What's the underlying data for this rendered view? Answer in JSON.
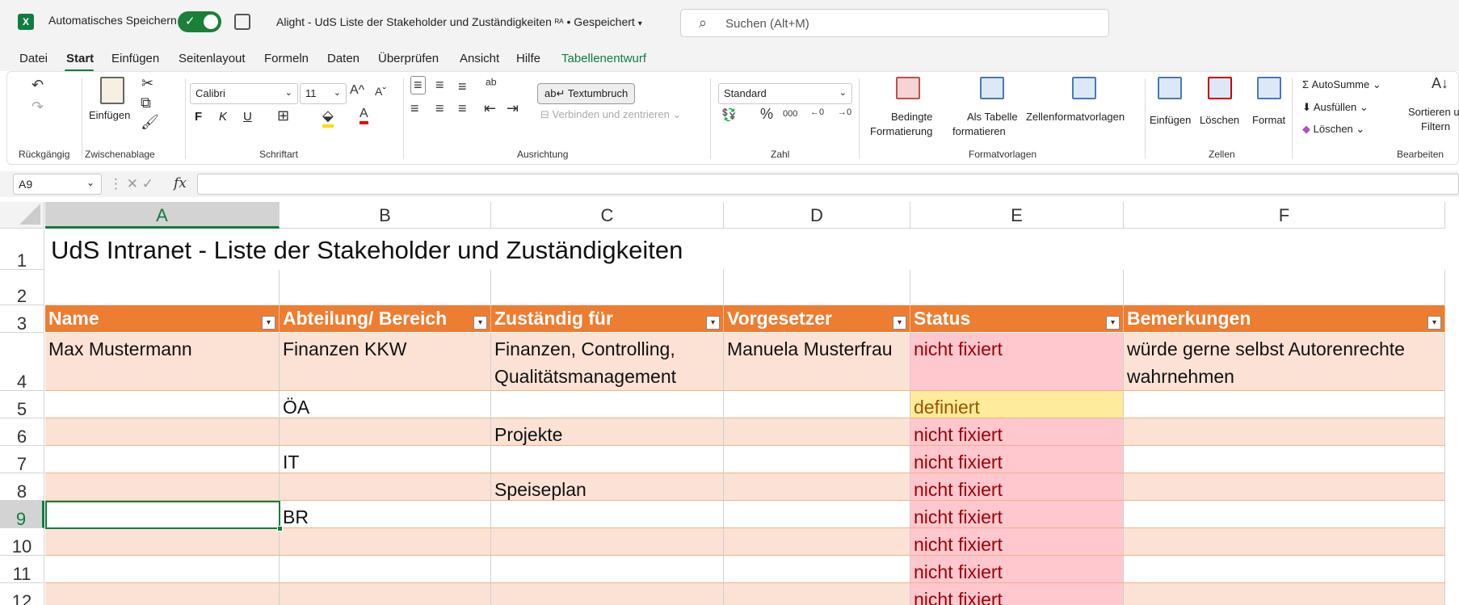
{
  "titlebar": {
    "app_icon": "excel-icon",
    "autosave_label": "Automatisches Speichern",
    "autosave_on": true,
    "document_title": "Alight - UdS Liste der Stakeholder und Zuständigkeiten",
    "status": "• Gespeichert",
    "search_placeholder": "Suchen (Alt+M)"
  },
  "menu": {
    "items": [
      "Datei",
      "Start",
      "Einfügen",
      "Seitenlayout",
      "Formeln",
      "Daten",
      "Überprüfen",
      "Ansicht",
      "Hilfe",
      "Tabellenentwurf"
    ],
    "active": "Start"
  },
  "ribbon": {
    "groups": [
      "Rückgängig",
      "Zwischenablage",
      "Schriftart",
      "Ausrichtung",
      "Zahl",
      "Formatvorlagen",
      "Zellen",
      "Bearbeiten"
    ],
    "paste_label": "Einfügen",
    "font_name": "Calibri",
    "font_size": "11",
    "bold": "F",
    "italic": "K",
    "underline": "U",
    "wrap_text": "Textumbruch",
    "merge_center": "Verbinden und zentrieren",
    "number_format": "Standard",
    "conditional_format_1": "Bedingte",
    "conditional_format_2": "Formatierung",
    "as_table_1": "Als Tabelle",
    "as_table_2": "formatieren",
    "cell_styles": "Zellenformatvorlagen",
    "insert": "Einfügen",
    "delete": "Löschen",
    "format": "Format",
    "autosum": "AutoSumme",
    "fill": "Ausfüllen",
    "clear": "Löschen",
    "sort_1": "Sortieren u",
    "sort_2": "Filtern"
  },
  "formula_bar": {
    "name_box": "A9",
    "fx": "fx",
    "content": ""
  },
  "sheet": {
    "columns": [
      "A",
      "B",
      "C",
      "D",
      "E",
      "F"
    ],
    "selected_column": "A",
    "rows": [
      "1",
      "2",
      "3",
      "4",
      "5",
      "6",
      "7",
      "8",
      "9",
      "10",
      "11",
      "12"
    ],
    "selected_row": "9",
    "title": "UdS Intranet - Liste der Stakeholder und Zuständigkeiten",
    "table_headers": [
      "Name",
      "Abteilung/ Bereich",
      "Zuständig für",
      "Vorgesetzer",
      "Status",
      "Bemerkungen"
    ],
    "table_rows": [
      [
        "Max Mustermann",
        "Finanzen KKW",
        "Finanzen, Controlling, Qualitätsmanagement",
        "Manuela Musterfrau",
        "nicht fixiert",
        "würde gerne selbst Autorenrechte wahrnehmen"
      ],
      [
        "",
        "ÖA",
        "",
        "",
        "definiert",
        ""
      ],
      [
        "",
        "",
        "Projekte",
        "",
        "nicht fixiert",
        ""
      ],
      [
        "",
        "IT",
        "",
        "",
        "nicht fixiert",
        ""
      ],
      [
        "",
        "",
        "Speiseplan",
        "",
        "nicht fixiert",
        ""
      ],
      [
        "",
        "BR",
        "",
        "",
        "nicht fixiert",
        ""
      ],
      [
        "",
        "",
        "",
        "",
        "nicht fixiert",
        ""
      ],
      [
        "",
        "",
        "",
        "",
        "nicht fixiert",
        ""
      ],
      [
        "",
        "",
        "",
        "",
        "nicht fixiert",
        ""
      ]
    ],
    "colors": {
      "header_fill": "#ed7d31",
      "band_fill": "#fbe2d5",
      "bad_fill": "#ffc7ce",
      "bad_text": "#9c0006",
      "neutral_fill": "#ffeb9c",
      "neutral_text": "#9c5700",
      "selection": "#107c41"
    }
  }
}
